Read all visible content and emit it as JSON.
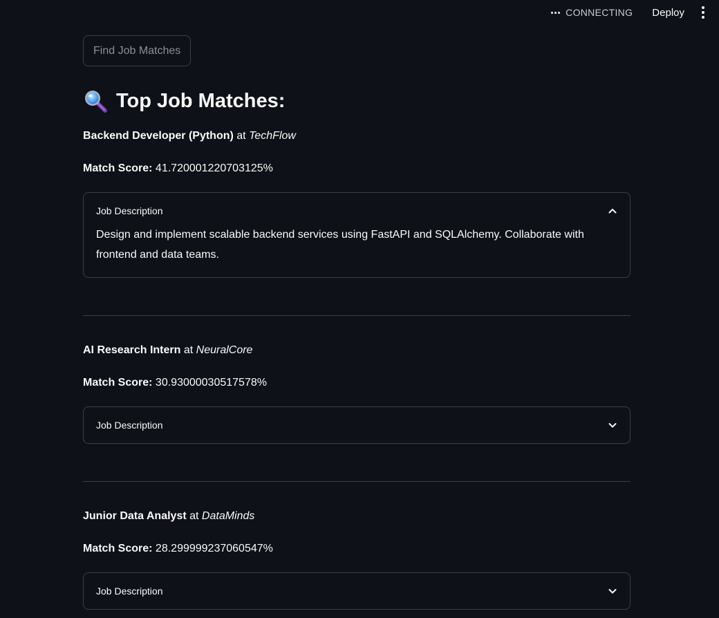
{
  "topbar": {
    "status": "CONNECTING",
    "deploy_label": "Deploy"
  },
  "find_button": {
    "label": "Find Job Matches"
  },
  "heading": {
    "emoji": "magnifying-glass-icon",
    "text": "Top Job Matches:"
  },
  "jobs": [
    {
      "title": "Backend Developer (Python)",
      "at": "at",
      "company": "TechFlow",
      "score_label": "Match Score:",
      "score_value": "41.720001220703125%",
      "expander_label": "Job Description",
      "expanded": true,
      "description": "Design and implement scalable backend services using FastAPI and SQLAlchemy. Collaborate with frontend and data teams."
    },
    {
      "title": "AI Research Intern",
      "at": "at",
      "company": "NeuralCore",
      "score_label": "Match Score:",
      "score_value": "30.93000030517578%",
      "expander_label": "Job Description",
      "expanded": false
    },
    {
      "title": "Junior Data Analyst",
      "at": "at",
      "company": "DataMinds",
      "score_label": "Match Score:",
      "score_value": "28.299999237060547%",
      "expander_label": "Job Description",
      "expanded": false
    }
  ],
  "colors": {
    "background": "#0e1117",
    "text": "#fafafa",
    "border": "#3c3f47",
    "muted": "#8b8f98"
  }
}
